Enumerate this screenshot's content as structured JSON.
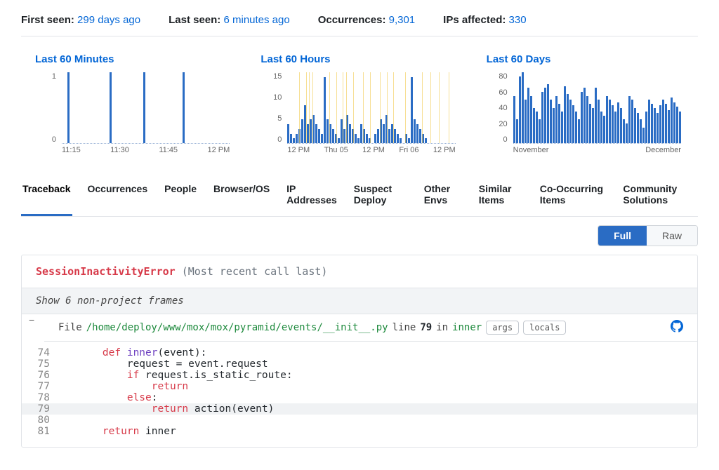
{
  "summary": {
    "first_seen_label": "First seen:",
    "first_seen_value": "299 days ago",
    "last_seen_label": "Last seen:",
    "last_seen_value": "6 minutes ago",
    "occurrences_label": "Occurrences:",
    "occurrences_value": "9,301",
    "ips_label": "IPs affected:",
    "ips_value": "330"
  },
  "charts": {
    "minutes": {
      "title": "Last 60 Minutes",
      "ylabels": [
        "1",
        "0"
      ],
      "xlabels": [
        "11:15",
        "11:30",
        "11:45",
        "12 PM"
      ]
    },
    "hours": {
      "title": "Last 60 Hours",
      "ylabels": [
        "15",
        "10",
        "5",
        "0"
      ],
      "xlabels": [
        "12 PM",
        "Thu 05",
        "12 PM",
        "Fri 06",
        "12 PM"
      ]
    },
    "days": {
      "title": "Last 60 Days",
      "ylabels": [
        "80",
        "60",
        "40",
        "20",
        "0"
      ],
      "xlabels": [
        "November",
        "December"
      ]
    }
  },
  "chart_data": [
    {
      "id": "minutes",
      "type": "bar",
      "title": "Last 60 Minutes",
      "ylim": [
        0,
        1
      ],
      "x_ticks": [
        "11:15",
        "11:30",
        "11:45",
        "12 PM"
      ],
      "values": [
        0,
        0,
        1,
        0,
        0,
        0,
        0,
        0,
        0,
        0,
        0,
        0,
        0,
        0,
        0,
        0,
        0,
        1,
        0,
        0,
        0,
        0,
        0,
        0,
        0,
        0,
        0,
        0,
        0,
        1,
        0,
        0,
        0,
        0,
        0,
        0,
        0,
        0,
        0,
        0,
        0,
        0,
        0,
        1,
        0,
        0,
        0,
        0,
        0,
        0,
        0,
        0,
        0,
        0,
        0,
        0,
        0,
        0,
        0,
        0
      ]
    },
    {
      "id": "hours",
      "type": "bar",
      "title": "Last 60 Hours",
      "ylim": [
        0,
        15
      ],
      "x_ticks": [
        "12 PM",
        "Thu 05",
        "12 PM",
        "Fri 06",
        "12 PM"
      ],
      "deploy_markers": [
        0.07,
        0.11,
        0.13,
        0.15,
        0.25,
        0.29,
        0.33,
        0.35,
        0.39,
        0.45,
        0.49,
        0.55,
        0.59,
        0.63,
        0.7,
        0.8,
        0.85,
        0.9,
        0.96
      ],
      "values": [
        4,
        2,
        1,
        2,
        3,
        5,
        8,
        4,
        5,
        6,
        4,
        3,
        2,
        14,
        5,
        4,
        3,
        2,
        1,
        5,
        3,
        6,
        4,
        3,
        2,
        1,
        4,
        3,
        2,
        1,
        0,
        2,
        3,
        5,
        4,
        6,
        3,
        4,
        3,
        2,
        1,
        0,
        2,
        1,
        14,
        5,
        4,
        3,
        2,
        1,
        0,
        0,
        0,
        0,
        0,
        0,
        0,
        0,
        0,
        0
      ]
    },
    {
      "id": "days",
      "type": "bar",
      "title": "Last 60 Days",
      "ylim": [
        0,
        90
      ],
      "x_ticks": [
        "November",
        "December"
      ],
      "values": [
        60,
        30,
        85,
        90,
        55,
        70,
        60,
        45,
        40,
        30,
        65,
        70,
        75,
        55,
        45,
        60,
        50,
        40,
        72,
        62,
        55,
        48,
        40,
        30,
        65,
        70,
        60,
        50,
        45,
        70,
        55,
        40,
        35,
        60,
        55,
        48,
        40,
        52,
        45,
        30,
        25,
        60,
        55,
        45,
        38,
        30,
        20,
        40,
        55,
        50,
        45,
        38,
        48,
        55,
        50,
        42,
        58,
        52,
        46,
        40
      ]
    }
  ],
  "tabs": [
    "Traceback",
    "Occurrences",
    "People",
    "Browser/OS",
    "IP Addresses",
    "Suspect Deploy",
    "Other Envs",
    "Similar Items",
    "Co-Occurring Items",
    "Community Solutions"
  ],
  "active_tab": 0,
  "toggle": {
    "full": "Full",
    "raw": "Raw",
    "active": "full"
  },
  "traceback": {
    "error_name": "SessionInactivityError",
    "most_recent": "(Most recent call last)",
    "show_frames": "Show 6 non-project frames",
    "frame": {
      "prefix": "File",
      "path": "/home/deploy/www/mox/mox/pyramid/events/__init__.py",
      "line_word": "line",
      "line_no": "79",
      "in_word": "in",
      "func": "inner",
      "args_btn": "args",
      "locals_btn": "locals"
    },
    "code": [
      {
        "n": 74,
        "tokens": [
          [
            "    ",
            ""
          ],
          [
            "def ",
            "kw"
          ],
          [
            "inner",
            "fn"
          ],
          [
            "(event):",
            ""
          ]
        ]
      },
      {
        "n": 75,
        "tokens": [
          [
            "        request = event.request",
            ""
          ]
        ]
      },
      {
        "n": 76,
        "tokens": [
          [
            "        ",
            ""
          ],
          [
            "if ",
            "kw"
          ],
          [
            "request.is_static_route:",
            ""
          ]
        ]
      },
      {
        "n": 77,
        "tokens": [
          [
            "            ",
            ""
          ],
          [
            "return",
            "kw"
          ]
        ]
      },
      {
        "n": 78,
        "tokens": [
          [
            "        ",
            ""
          ],
          [
            "else",
            "kw"
          ],
          [
            ":",
            ""
          ]
        ]
      },
      {
        "n": 79,
        "tokens": [
          [
            "            ",
            ""
          ],
          [
            "return ",
            "kw"
          ],
          [
            "action(event)",
            ""
          ]
        ],
        "hl": true
      },
      {
        "n": 80,
        "tokens": [
          [
            "",
            ""
          ]
        ]
      },
      {
        "n": 81,
        "tokens": [
          [
            "    ",
            ""
          ],
          [
            "return ",
            "kw"
          ],
          [
            "inner",
            ""
          ]
        ]
      }
    ]
  }
}
